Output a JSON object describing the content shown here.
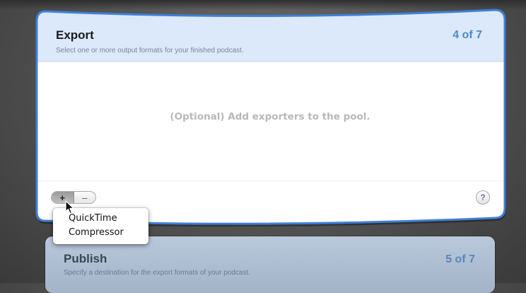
{
  "export_step": {
    "title": "Export",
    "subtitle": "Select one or more output formats for your finished podcast.",
    "step_label": "4 of 7",
    "placeholder": "(Optional) Add exporters to the pool.",
    "add_label": "+",
    "remove_label": "–",
    "help_label": "?"
  },
  "menu": {
    "items": [
      "QuickTime",
      "Compressor"
    ]
  },
  "next_step": {
    "title": "Publish",
    "subtitle": "Specify a destination for the export formats of your podcast.",
    "step_label": "5 of 7"
  },
  "colors": {
    "accent": "#4a8ad0",
    "card_border": "#3f7fd8",
    "header_bg": "#dce9fb"
  },
  "icons": {
    "help": "question-mark-icon",
    "cursor": "arrow-cursor-icon"
  }
}
